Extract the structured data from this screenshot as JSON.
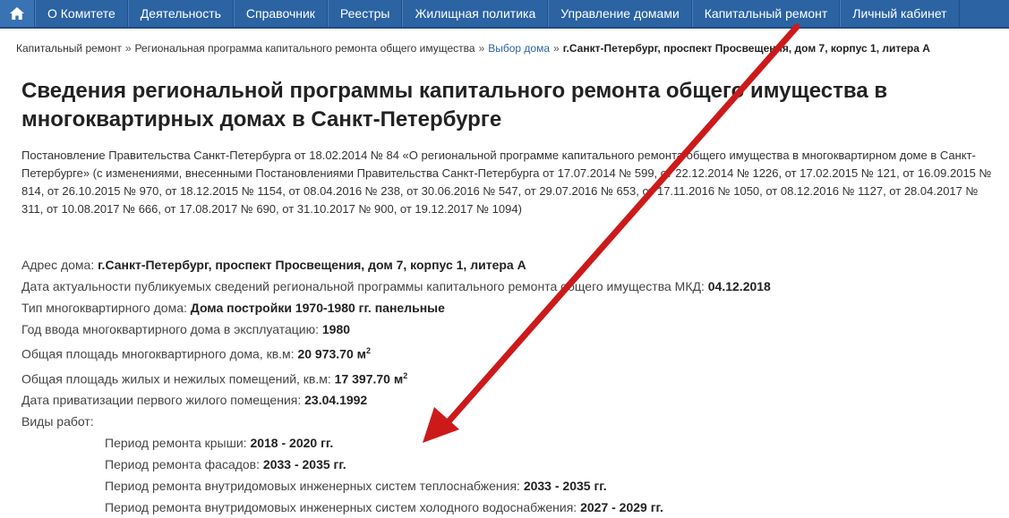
{
  "nav": {
    "items": [
      "О Комитете",
      "Деятельность",
      "Справочник",
      "Реестры",
      "Жилищная политика",
      "Управление домами",
      "Капитальный ремонт",
      "Личный кабинет"
    ]
  },
  "breadcrumb": {
    "c1": "Капитальный ремонт",
    "c2": "Региональная программа капитального ремонта общего имущества",
    "c3": "Выбор дома",
    "c4": "г.Санкт-Петербург, проспект Просвещения, дом 7, корпус 1, литера А",
    "sep": "»"
  },
  "title": "Сведения региональной программы капитального ремонта общего имущества в многоквартирных домах в Санкт-Петербурге",
  "intro": "Постановление Правительства Санкт-Петербурга от 18.02.2014 № 84 «О региональной программе капитального ремонта общего имущества в многоквартирном доме в Санкт-Петербурге» (с изменениями, внесенными Постановлениями Правительства Санкт-Петербурга от 17.07.2014 № 599, от 22.12.2014 № 1226, от 17.02.2015 № 121, от 16.09.2015 № 814, от 26.10.2015 № 970, от 18.12.2015 № 1154, от 08.04.2016 № 238, от 30.06.2016 № 547, от 29.07.2016 № 653, от 17.11.2016 № 1050, от 08.12.2016 № 1127, от 28.04.2017 № 311, от 10.08.2017 № 666, от 17.08.2017 № 690, от 31.10.2017 № 900, от 19.12.2017 № 1094)",
  "details": {
    "address_label": "Адрес дома:",
    "address_value": "г.Санкт-Петербург, проспект Просвещения, дом 7, корпус 1, литера А",
    "date_label": "Дата актуальности публикуемых сведений региональной программы капитального ремонта общего имущества МКД:",
    "date_value": "04.12.2018",
    "type_label": "Тип многоквартирного дома:",
    "type_value": "Дома постройки 1970-1980 гг. панельные",
    "year_label": "Год ввода многоквартирного дома в эксплуатацию:",
    "year_value": "1980",
    "area_label": "Общая площадь многоквартирного дома, кв.м:",
    "area_value": "20 973.70 м",
    "living_label": "Общая площадь жилых и нежилых помещений, кв.м:",
    "living_value": "17 397.70 м",
    "sup": "2",
    "priv_label": "Дата приватизации первого жилого помещения:",
    "priv_value": "23.04.1992",
    "works_label": "Виды работ:"
  },
  "works": [
    {
      "label": "Период ремонта крыши:",
      "value": "2018 - 2020 гг."
    },
    {
      "label": "Период ремонта фасадов:",
      "value": "2033 - 2035 гг."
    },
    {
      "label": "Период ремонта внутридомовых инженерных систем теплоснабжения:",
      "value": "2033 - 2035 гг."
    },
    {
      "label": "Период ремонта внутридомовых инженерных систем холодного водоснабжения:",
      "value": "2027 - 2029 гг."
    }
  ],
  "colors": {
    "nav_bg": "#2b63a3",
    "link": "#2b63a3",
    "arrow": "#cc1a1a"
  }
}
